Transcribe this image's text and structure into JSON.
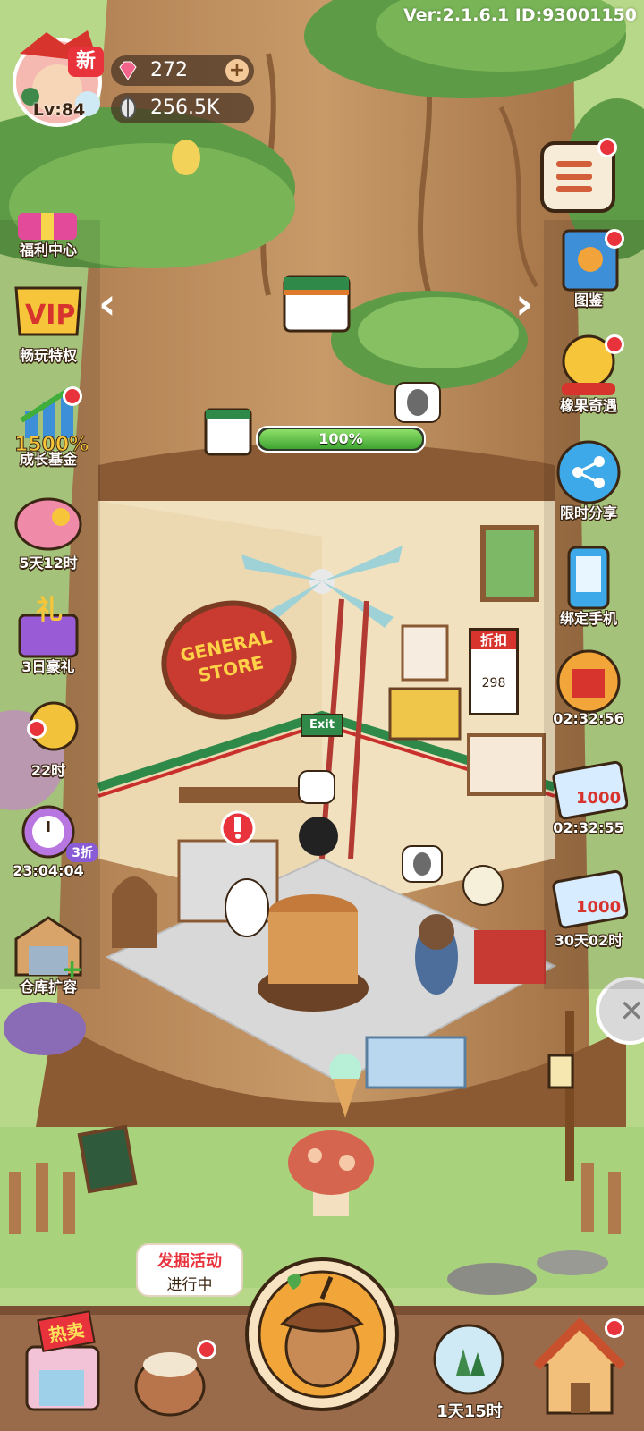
{
  "header": {
    "version": "Ver:2.1.6.1 ID:93001150",
    "level": "Lv:84",
    "avatar_badge": "新",
    "gems": "272",
    "seeds": "256.5K"
  },
  "left_menu": [
    {
      "label": "福利中心",
      "icon": "gift-box-icon"
    },
    {
      "label": "畅玩特权",
      "icon": "vip-icon",
      "icon_text": "VIP"
    },
    {
      "label": "成长基金",
      "icon": "growth-fund-icon",
      "icon_text": "1500%"
    },
    {
      "label": "5天12时",
      "icon": "piggy-bank-icon"
    },
    {
      "label": "3日豪礼",
      "icon": "gift-icon",
      "icon_text": "礼"
    },
    {
      "label": "22时",
      "icon": "golden-cat-icon"
    },
    {
      "label": "23:04:04",
      "icon": "alarm-clock-icon",
      "tag": "3折"
    },
    {
      "label": "仓库扩容",
      "icon": "warehouse-icon"
    }
  ],
  "right_menu": [
    {
      "label": "图鉴",
      "icon": "encyclopedia-icon"
    },
    {
      "label": "橡果奇遇",
      "icon": "acorn-adventure-icon"
    },
    {
      "label": "限时分享",
      "icon": "share-icon"
    },
    {
      "label": "绑定手机",
      "icon": "bind-phone-icon"
    },
    {
      "label": "02:32:56",
      "icon": "shop-offer-icon"
    },
    {
      "label": "02:32:55",
      "icon": "ticket-offer-icon",
      "icon_text": "1000"
    },
    {
      "label": "30天02时",
      "icon": "ticket-offer-icon",
      "icon_text": "1000"
    }
  ],
  "store": {
    "sign_line1": "GENERAL",
    "sign_line2": "STORE",
    "progress_percent": 100,
    "progress_label": "100%",
    "exit_sign": "Exit",
    "discount_sign": "折扣",
    "price_tag": "298"
  },
  "bottom": {
    "hot_sale": "热卖",
    "dig_event_line1": "发掘活动",
    "dig_event_line2": "进行中",
    "timer": "1天15时"
  },
  "colors": {
    "red_dot": "#e8323c",
    "progress_green": "#5ac43c",
    "wood_brown": "#8a5a35",
    "grass": "#a9d27c"
  }
}
